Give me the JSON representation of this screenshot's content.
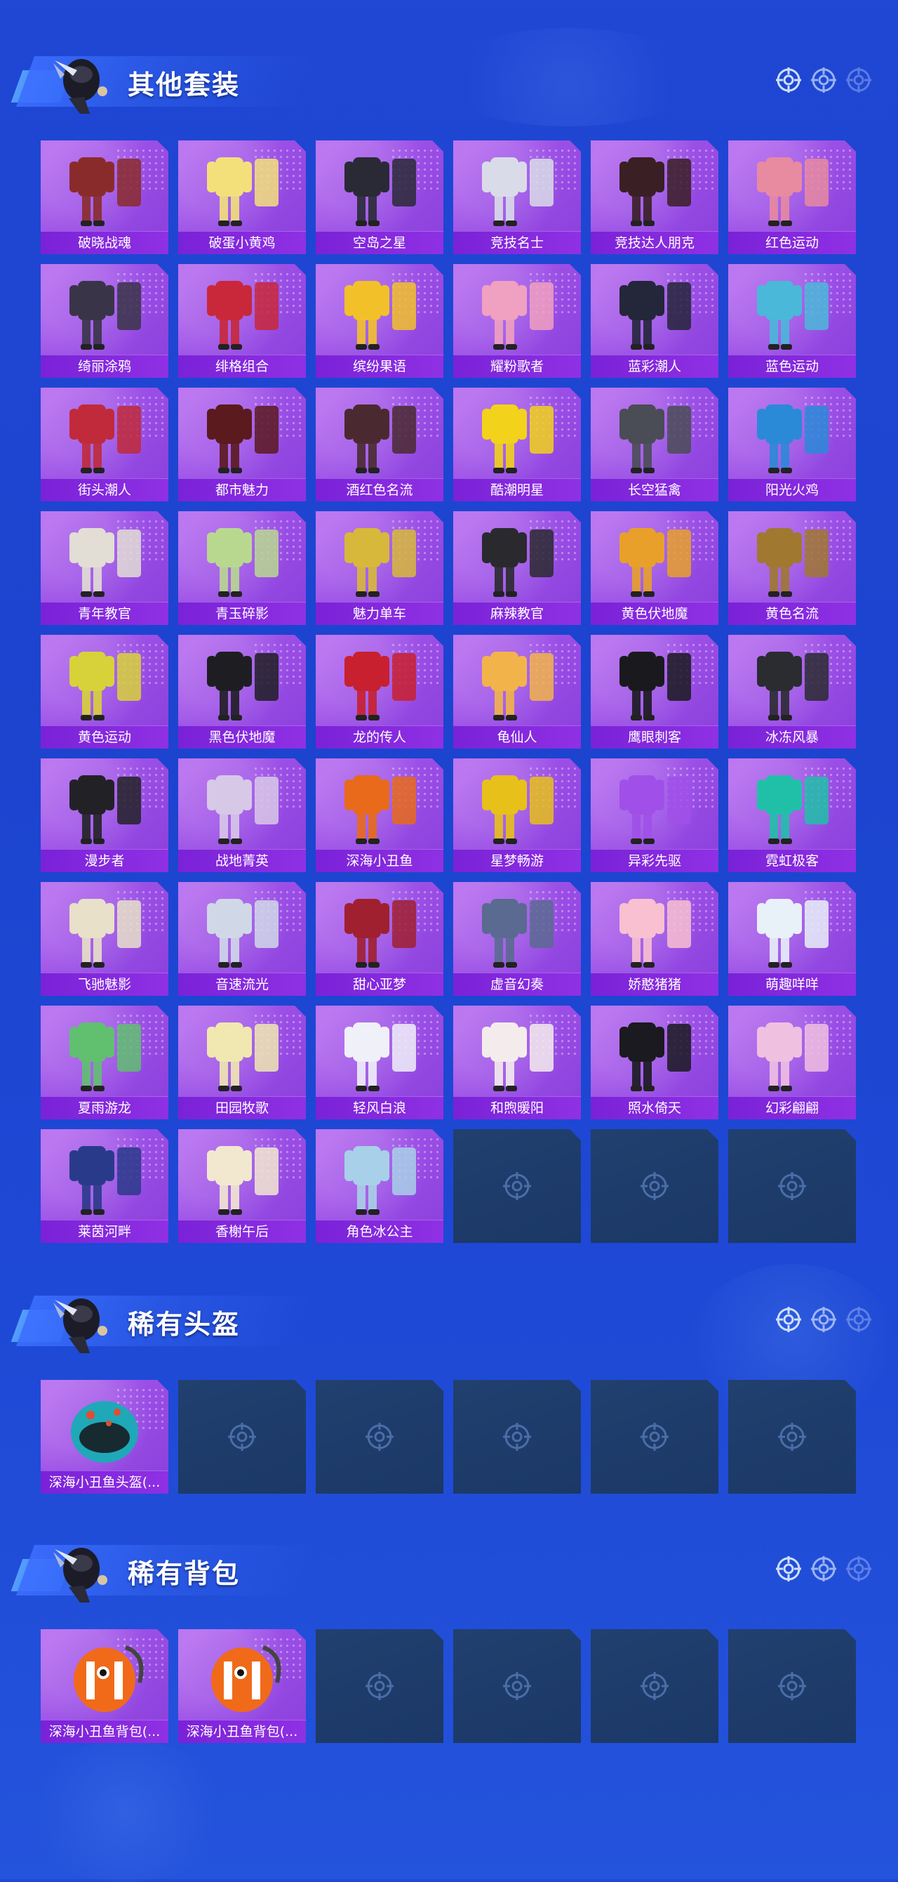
{
  "colors": {
    "background": "#1f47d4",
    "card_purple": "#9b4fe6",
    "label_bar": "#7a22d8",
    "empty_card": "#1e3c6b"
  },
  "sections": [
    {
      "title": "其他套装",
      "items": [
        {
          "name": "破晓战魂",
          "filled": true,
          "icon": "red-coat-outfit-icon",
          "accent": "#8a2b2b"
        },
        {
          "name": "破蛋小黄鸡",
          "filled": true,
          "icon": "yellow-chick-costume-icon",
          "accent": "#f3e07a"
        },
        {
          "name": "空岛之星",
          "filled": true,
          "icon": "dark-twin-outfit-icon",
          "accent": "#2a2a36"
        },
        {
          "name": "竞技名士",
          "filled": true,
          "icon": "white-tracksuit-icon",
          "accent": "#d9dce8"
        },
        {
          "name": "竞技达人朋克",
          "filled": true,
          "icon": "punk-outfit-icon",
          "accent": "#3a1f24"
        },
        {
          "name": "红色运动",
          "filled": true,
          "icon": "red-sport-outfit-icon",
          "accent": "#e88aa0"
        },
        {
          "name": "绮丽涂鸦",
          "filled": true,
          "icon": "graffiti-jacket-icon",
          "accent": "#3a3448"
        },
        {
          "name": "绯格组合",
          "filled": true,
          "icon": "red-plaid-set-icon",
          "accent": "#c8283a"
        },
        {
          "name": "缤纷果语",
          "filled": true,
          "icon": "fruit-print-set-icon",
          "accent": "#f2c12a"
        },
        {
          "name": "耀粉歌者",
          "filled": true,
          "icon": "pink-singer-outfit-icon",
          "accent": "#f0a0c0"
        },
        {
          "name": "蓝彩潮人",
          "filled": true,
          "icon": "dark-street-outfit-icon",
          "accent": "#24263a"
        },
        {
          "name": "蓝色运动",
          "filled": true,
          "icon": "blue-sport-outfit-icon",
          "accent": "#4ab8d8"
        },
        {
          "name": "街头潮人",
          "filled": true,
          "icon": "red-puffer-outfit-icon",
          "accent": "#c02a3a"
        },
        {
          "name": "都市魅力",
          "filled": true,
          "icon": "urban-dress-set-icon",
          "accent": "#5a1a1e"
        },
        {
          "name": "酒红色名流",
          "filled": true,
          "icon": "wine-suit-icon",
          "accent": "#4a2a30"
        },
        {
          "name": "酷潮明星",
          "filled": true,
          "icon": "yellow-puffer-icon",
          "accent": "#f2d21a"
        },
        {
          "name": "长空猛禽",
          "filled": true,
          "icon": "camo-jacket-icon",
          "accent": "#4a4c56"
        },
        {
          "name": "阳光火鸡",
          "filled": true,
          "icon": "blue-yellow-outfit-icon",
          "accent": "#2a8ad8"
        },
        {
          "name": "青年教官",
          "filled": true,
          "icon": "white-officer-jacket-icon",
          "accent": "#e2ddd5"
        },
        {
          "name": "青玉碎影",
          "filled": true,
          "icon": "jade-dress-icon",
          "accent": "#b8d890"
        },
        {
          "name": "魅力单车",
          "filled": true,
          "icon": "yellow-cycling-set-icon",
          "accent": "#d8b83a"
        },
        {
          "name": "麻辣教官",
          "filled": true,
          "icon": "black-white-uniform-icon",
          "accent": "#2a2a2e"
        },
        {
          "name": "黄色伏地魔",
          "filled": true,
          "icon": "yellow-hoodie-icon",
          "accent": "#e8a02a"
        },
        {
          "name": "黄色名流",
          "filled": true,
          "icon": "brown-suit-icon",
          "accent": "#a07830"
        },
        {
          "name": "黄色运动",
          "filled": true,
          "icon": "yellow-sport-jacket-icon",
          "accent": "#d8d23a"
        },
        {
          "name": "黑色伏地魔",
          "filled": true,
          "icon": "black-hoodie-icon",
          "accent": "#1e1e22"
        },
        {
          "name": "龙的传人",
          "filled": true,
          "icon": "red-qipao-icon",
          "accent": "#c8202e"
        },
        {
          "name": "龟仙人",
          "filled": true,
          "icon": "hawaiian-shirt-icon",
          "accent": "#f2b44a"
        },
        {
          "name": "鹰眼刺客",
          "filled": true,
          "icon": "black-leather-outfit-icon",
          "accent": "#1a1a1e"
        },
        {
          "name": "冰冻风暴",
          "filled": true,
          "icon": "dark-armor-outfit-icon",
          "accent": "#2a2c30"
        },
        {
          "name": "漫步者",
          "filled": true,
          "icon": "black-suit-icon",
          "accent": "#222226"
        },
        {
          "name": "战地菁英",
          "filled": true,
          "icon": "striped-jacket-icon",
          "accent": "#d8c8e8"
        },
        {
          "name": "深海小丑鱼",
          "filled": true,
          "icon": "clownfish-outfit-icon",
          "accent": "#e86a1a"
        },
        {
          "name": "星梦畅游",
          "filled": true,
          "icon": "colorful-astro-suit-icon",
          "accent": "#e8c01a"
        },
        {
          "name": "异彩先驱",
          "filled": true,
          "icon": "neon-mecha-suit-icon",
          "accent": "#a050e8"
        },
        {
          "name": "霓虹极客",
          "filled": true,
          "icon": "neon-geek-outfit-icon",
          "accent": "#20c0a8"
        },
        {
          "name": "飞驰魅影",
          "filled": true,
          "icon": "white-racer-suit-icon",
          "accent": "#e8e0c8"
        },
        {
          "name": "音速流光",
          "filled": true,
          "icon": "white-speed-suit-icon",
          "accent": "#d0d8e8"
        },
        {
          "name": "甜心亚梦",
          "filled": true,
          "icon": "sweet-red-dress-icon",
          "accent": "#a02030"
        },
        {
          "name": "虚音幻奏",
          "filled": true,
          "icon": "plaid-skirt-set-icon",
          "accent": "#5a6a90"
        },
        {
          "name": "娇憨猪猪",
          "filled": true,
          "icon": "pink-piggy-outfit-icon",
          "accent": "#f8c0d0"
        },
        {
          "name": "萌趣咩咩",
          "filled": true,
          "icon": "sheep-outfit-icon",
          "accent": "#e8f0f8"
        },
        {
          "name": "夏雨游龙",
          "filled": true,
          "icon": "green-dragon-suit-icon",
          "accent": "#60c070"
        },
        {
          "name": "田园牧歌",
          "filled": true,
          "icon": "cream-dress-set-icon",
          "accent": "#f0e8b0"
        },
        {
          "name": "轻风白浪",
          "filled": true,
          "icon": "white-sailor-dress-icon",
          "accent": "#f0f0f8"
        },
        {
          "name": "和煦暖阳",
          "filled": true,
          "icon": "white-casual-set-icon",
          "accent": "#f4ecec"
        },
        {
          "name": "照水倚天",
          "filled": true,
          "icon": "black-gold-outfit-icon",
          "accent": "#1a1a20"
        },
        {
          "name": "幻彩翩翩",
          "filled": true,
          "icon": "pastel-dress-icon",
          "accent": "#f0c0e0"
        },
        {
          "name": "莱茵河畔",
          "filled": true,
          "icon": "navy-blazer-set-icon",
          "accent": "#2a3a8a"
        },
        {
          "name": "香榭午后",
          "filled": true,
          "icon": "cream-coat-set-icon",
          "accent": "#f2e8d0"
        },
        {
          "name": "角色冰公主",
          "filled": true,
          "icon": "ice-princess-icon",
          "accent": "#a8d0e8"
        },
        {
          "name": "",
          "filled": false,
          "icon": "empty-slot-icon"
        },
        {
          "name": "",
          "filled": false,
          "icon": "empty-slot-icon"
        },
        {
          "name": "",
          "filled": false,
          "icon": "empty-slot-icon"
        }
      ]
    },
    {
      "title": "稀有头盔",
      "items": [
        {
          "name": "深海小丑鱼头盔(...",
          "filled": true,
          "icon": "clownfish-helmet-icon",
          "accent": "#1fa8b8"
        },
        {
          "name": "",
          "filled": false,
          "icon": "empty-slot-icon"
        },
        {
          "name": "",
          "filled": false,
          "icon": "empty-slot-icon"
        },
        {
          "name": "",
          "filled": false,
          "icon": "empty-slot-icon"
        },
        {
          "name": "",
          "filled": false,
          "icon": "empty-slot-icon"
        },
        {
          "name": "",
          "filled": false,
          "icon": "empty-slot-icon"
        }
      ]
    },
    {
      "title": "稀有背包",
      "items": [
        {
          "name": "深海小丑鱼背包(...",
          "filled": true,
          "icon": "clownfish-backpack-icon",
          "accent": "#f06a1a"
        },
        {
          "name": "深海小丑鱼背包(...",
          "filled": true,
          "icon": "clownfish-backpack-icon",
          "accent": "#f06a1a"
        },
        {
          "name": "",
          "filled": false,
          "icon": "empty-slot-icon"
        },
        {
          "name": "",
          "filled": false,
          "icon": "empty-slot-icon"
        },
        {
          "name": "",
          "filled": false,
          "icon": "empty-slot-icon"
        },
        {
          "name": "",
          "filled": false,
          "icon": "empty-slot-icon"
        }
      ]
    }
  ]
}
